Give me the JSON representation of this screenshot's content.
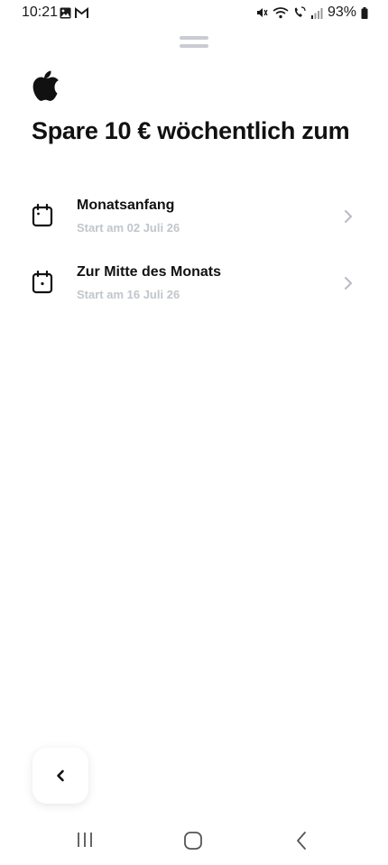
{
  "status_bar": {
    "time": "10:21",
    "battery": "93%",
    "icons_left": [
      "gallery-icon",
      "gmail-icon"
    ],
    "icons_right": [
      "mute-icon",
      "wifi-icon",
      "wifi-call-icon",
      "signal-icon",
      "battery-icon"
    ]
  },
  "header": {
    "logo": "apple-logo",
    "title": "Spare 10 € wöchentlich zum"
  },
  "options": [
    {
      "title": "Monatsanfang",
      "subtitle": "Start am 02 Juli 26",
      "icon": "calendar-icon"
    },
    {
      "title": "Zur Mitte des Monats",
      "subtitle": "Start am 16 Juli 26",
      "icon": "calendar-mid-icon"
    }
  ],
  "footer": {
    "back_icon": "chevron-left-icon"
  },
  "nav_bar": {
    "buttons": [
      "recents-icon",
      "home-icon",
      "back-icon"
    ]
  }
}
